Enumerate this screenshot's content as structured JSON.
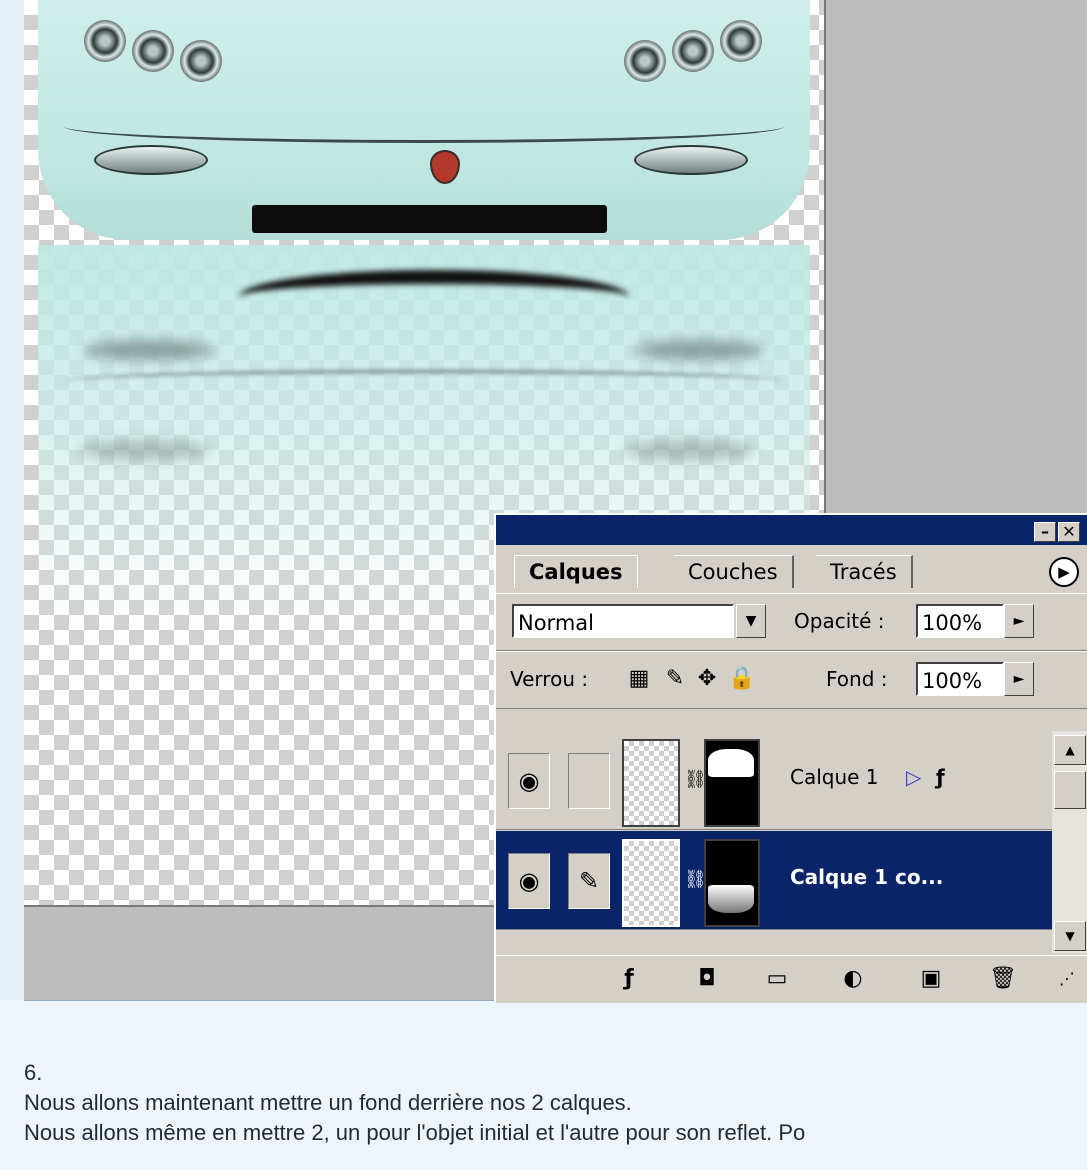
{
  "panel": {
    "tabs": [
      "Calques",
      "Couches",
      "Tracés"
    ],
    "blend_mode": "Normal",
    "opacity_label": "Opacité :",
    "opacity_value": "100%",
    "lock_label": "Verrou :",
    "fill_label": "Fond :",
    "fill_value": "100%",
    "layers": [
      {
        "name": "Calque 1",
        "selected": false
      },
      {
        "name": "Calque 1 co...",
        "selected": true
      }
    ],
    "icons": [
      "layer-style-icon",
      "mask-icon",
      "folder-icon",
      "adjustment-icon",
      "new-layer-icon",
      "trash-icon"
    ]
  },
  "article": {
    "step": "6.",
    "line1": "Nous allons maintenant mettre un fond derrière nos 2 calques.",
    "line2": "Nous allons même en mettre 2, un pour l'objet initial et l'autre pour son reflet. Po"
  }
}
